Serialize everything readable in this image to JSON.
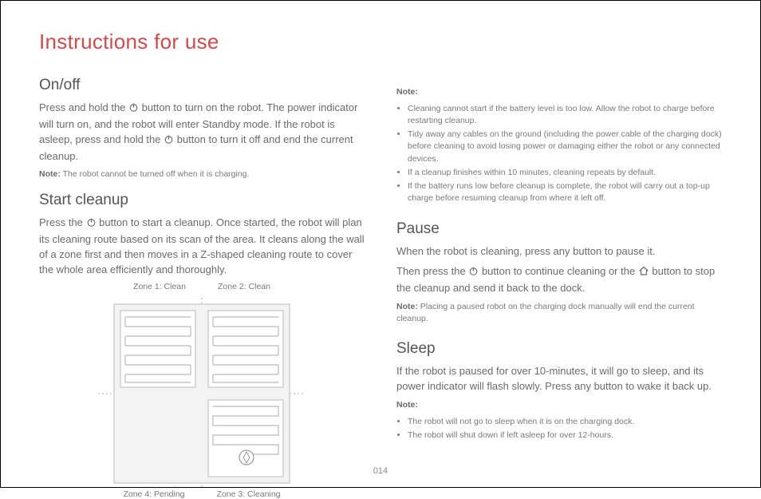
{
  "title": "Instructions for use",
  "page_number": "014",
  "onoff": {
    "heading": "On/off",
    "p1a": "Press and hold the ",
    "p1b": " button to turn on the robot. The power indicator will turn on, and the robot will enter Standby mode. If the robot is asleep, press and hold the ",
    "p1c": " button to turn it off and end the current cleanup.",
    "note_label": "Note:",
    "note": " The robot cannot be turned off when it is charging."
  },
  "start": {
    "heading": "Start cleanup",
    "p1a": "Press the ",
    "p1b": " button to start a cleanup. Once started, the robot will plan its cleaning route based on its scan of the area. It cleans along the wall of a zone first and then moves in a Z-shaped cleaning route to cover the whole area efficiently and thoroughly."
  },
  "zones": {
    "z1": "Zone 1: Clean",
    "z2": "Zone 2: Clean",
    "z3": "Zone 3: Cleaning",
    "z4": "Zone 4: Pending"
  },
  "notes_right": {
    "label": "Note:",
    "items": [
      "Cleaning cannot start if the battery level is too low. Allow the robot to charge before restarting cleanup.",
      "Tidy away any cables on the ground (including the power cable of the charging dock) before cleaning to avoid losing power or damaging either the robot or any connected devices.",
      "If a cleanup finishes within 10 minutes, cleaning repeats by default.",
      "If the battery runs low before cleanup is complete, the robot will carry out a top-up charge before resuming cleanup from where it left off."
    ]
  },
  "pause": {
    "heading": "Pause",
    "p1": "When the robot is cleaning, press any button to pause it.",
    "p2a": "Then press the ",
    "p2b": " button to continue cleaning or the ",
    "p2c": " button to stop the cleanup and send it back to the dock.",
    "note_label": "Note:",
    "note": " Placing a paused robot on the charging dock manually will end the current cleanup."
  },
  "sleep": {
    "heading": "Sleep",
    "p1": "If the robot is paused for over 10-minutes, it will go to sleep, and its power indicator will flash slowly. Press any button to wake it back up.",
    "note_label": "Note:",
    "items": [
      "The robot will not go to sleep when it is on the charging dock.",
      "The robot will shut down if left asleep for over 12-hours."
    ]
  }
}
